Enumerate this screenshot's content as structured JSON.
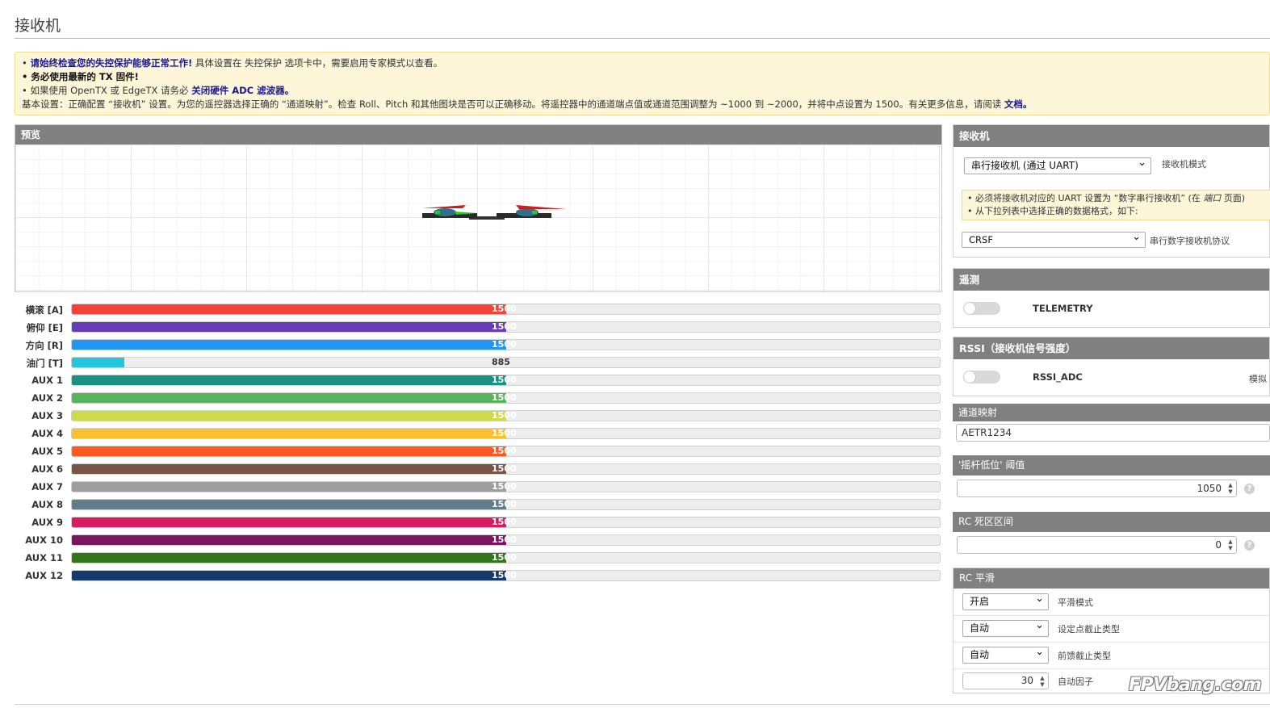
{
  "page": {
    "title": "接收机"
  },
  "notice": {
    "line1_bold": "请始终检查您的失控保护能够正常工作!",
    "line1_rest": "具体设置在 失控保护 选项卡中，需要启用专家模式以查看。",
    "line2": "务必使用最新的 TX 固件!",
    "line3_pre": "如果使用 OpenTX 或 EdgeTX 请务必",
    "line3_link": "关闭硬件 ADC 滤波器。",
    "line4": "基本设置：正确配置 “接收机” 设置。为您的遥控器选择正确的 “通道映射”。检查 Roll、Pitch 和其他图块是否可以正确移动。将遥控器中的通道端点值或通道范围调整为 ~1000 到 ~2000，并将中点设置为 1500。有关更多信息，请阅读",
    "line4_link": "文档。"
  },
  "preview": {
    "title": "预览"
  },
  "channels": [
    {
      "label": "横滚 [A]",
      "value": "1500",
      "fill": 0.5,
      "color": "#f44336"
    },
    {
      "label": "俯仰 [E]",
      "value": "1500",
      "fill": 0.5,
      "color": "#673ab7"
    },
    {
      "label": "方向 [R]",
      "value": "1500",
      "fill": 0.5,
      "color": "#2196f3"
    },
    {
      "label": "油门 [T]",
      "value": "885",
      "fill": 0.06,
      "color": "#26c6da"
    },
    {
      "label": "AUX 1",
      "value": "1500",
      "fill": 0.5,
      "color": "#1a9283"
    },
    {
      "label": "AUX 2",
      "value": "1500",
      "fill": 0.5,
      "color": "#5bb35e"
    },
    {
      "label": "AUX 3",
      "value": "1500",
      "fill": 0.5,
      "color": "#cddc4b"
    },
    {
      "label": "AUX 4",
      "value": "1500",
      "fill": 0.5,
      "color": "#fbc02d"
    },
    {
      "label": "AUX 5",
      "value": "1500",
      "fill": 0.5,
      "color": "#ff5722"
    },
    {
      "label": "AUX 6",
      "value": "1500",
      "fill": 0.5,
      "color": "#795548"
    },
    {
      "label": "AUX 7",
      "value": "1500",
      "fill": 0.5,
      "color": "#9e9e9e"
    },
    {
      "label": "AUX 8",
      "value": "1500",
      "fill": 0.5,
      "color": "#607d8b"
    },
    {
      "label": "AUX 9",
      "value": "1500",
      "fill": 0.5,
      "color": "#d81b60"
    },
    {
      "label": "AUX 10",
      "value": "1500",
      "fill": 0.5,
      "color": "#7b1560"
    },
    {
      "label": "AUX 11",
      "value": "1500",
      "fill": 0.5,
      "color": "#33741c"
    },
    {
      "label": "AUX 12",
      "value": "1500",
      "fill": 0.5,
      "color": "#15396b"
    }
  ],
  "receiver": {
    "title": "接收机",
    "mode_value": "串行接收机 (通过 UART)",
    "mode_label": "接收机模式",
    "warn1_pre": "必须将接收机对应的 UART 设置为 “数字串行接收机” (在",
    "warn1_em": "端口",
    "warn1_post": "页面)",
    "warn2": "从下拉列表中选择正确的数据格式，如下:",
    "protocol_value": "CRSF",
    "protocol_label": "串行数字接收机协议"
  },
  "telemetry": {
    "title": "遥测",
    "label": "TELEMETRY",
    "enabled": false
  },
  "rssi": {
    "title": "RSSI（接收机信号强度）",
    "label": "RSSI_ADC",
    "right_label": "模拟",
    "enabled": false
  },
  "channel_map": {
    "title": "通道映射",
    "value": "AETR1234"
  },
  "stick_low": {
    "title": "'摇杆低位' 阈值",
    "value": "1050"
  },
  "deadband": {
    "title": "RC 死区区间",
    "value": "0"
  },
  "smoothing": {
    "title": "RC 平滑",
    "mode_value": "开启",
    "mode_label": "平滑模式",
    "setpoint_value": "自动",
    "setpoint_label": "设定点截止类型",
    "ff_value": "自动",
    "ff_label": "前馈截止类型",
    "factor_value": "30",
    "factor_label": "自动因子"
  },
  "watermark": "FPVbang.com",
  "help_icon": "question-circle-icon"
}
